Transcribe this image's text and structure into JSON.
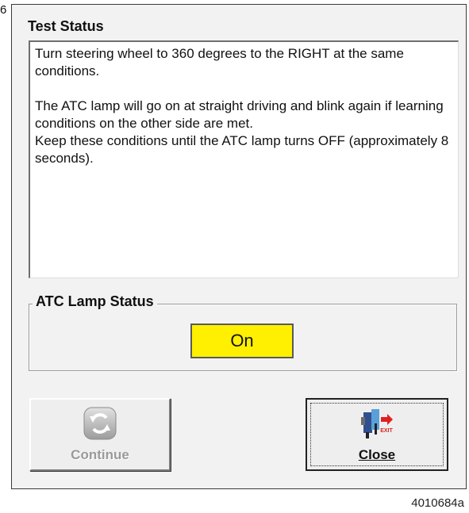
{
  "figure": {
    "side_number": "6",
    "figure_id": "4010684a"
  },
  "test_status": {
    "title": "Test Status",
    "paragraph_1": "Turn steering wheel to 360 degrees to the RIGHT at the same conditions.",
    "paragraph_2": "The ATC lamp will go on at straight driving and blink again if learning conditions on the other side are met.",
    "paragraph_3": "Keep these conditions until the ATC lamp turns OFF (approximately 8 seconds)."
  },
  "atc_lamp": {
    "title": "ATC Lamp Status",
    "value": "On",
    "indicator_color": "#ffef00"
  },
  "buttons": {
    "continue_label": "Continue",
    "continue_icon": "refresh-icon",
    "continue_enabled": false,
    "close_label": "Close",
    "close_icon": "exit-icon",
    "close_icon_text": "EXIT"
  }
}
